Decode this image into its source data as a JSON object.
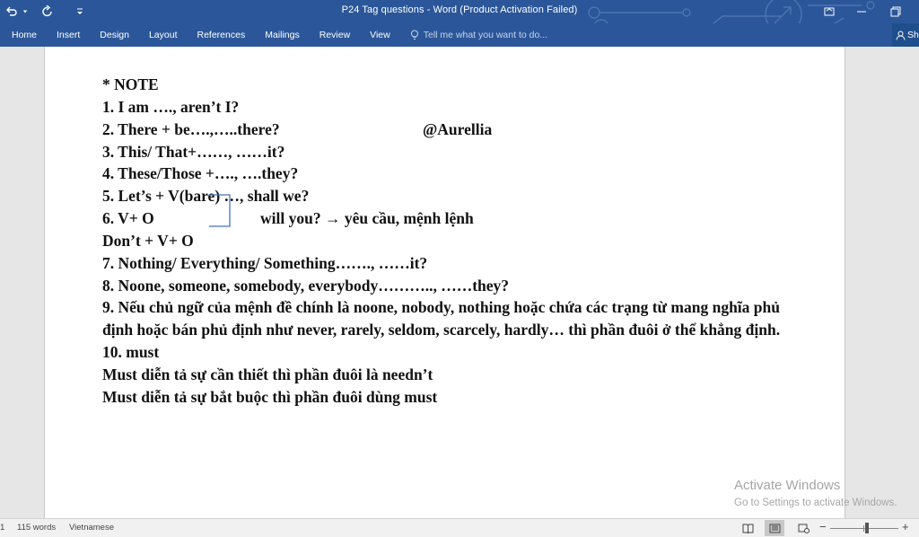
{
  "window": {
    "title": "P24 Tag questions - Word (Product Activation Failed)"
  },
  "ribbon": {
    "tabs": [
      "Home",
      "Insert",
      "Design",
      "Layout",
      "References",
      "Mailings",
      "Review",
      "View"
    ],
    "tell_me_placeholder": "Tell me what you want to do...",
    "share_label": "Sh"
  },
  "document": {
    "lines": [
      "* NOTE",
      "1. I am …., aren’t I?",
      "2. There + be….,…..there?",
      "3. This/ That+……, ……it?",
      "4. These/Those +…., ….they?",
      "5. Let’s + V(bare) …, shall we?",
      "6. V+ O",
      "Don’t + V+ O",
      "7. Nothing/ Everything/ Something……., ……it?",
      "8. Noone, someone, somebody, everybody……….., ……they?",
      "9. Nếu chủ ngữ của mệnh đề chính là noone, nobody, nothing hoặc chứa các trạng từ mang nghĩa phủ",
      "định hoặc bán phủ định như never, rarely, seldom, scarcely, hardly… thì phần đuôi ở thể khẳng định.",
      "10. must",
      "Must  diễn tả sự cần thiết thì phần đuôi là needn’t",
      "Must diễn tả sự bắt buộc thì phần đuôi dùng must"
    ],
    "author_tag": "@Aurellia",
    "will_you_note": "will you? → yêu cầu, mệnh lệnh"
  },
  "watermark": {
    "line1": "Activate Windows",
    "line2": "Go to Settings to activate Windows."
  },
  "status": {
    "page": "1",
    "words": "115 words",
    "language": "Vietnamese"
  },
  "colors": {
    "ribbon_blue": "#2b579a",
    "page_bg": "#ffffff",
    "canvas_bg": "#e6e6e6"
  }
}
